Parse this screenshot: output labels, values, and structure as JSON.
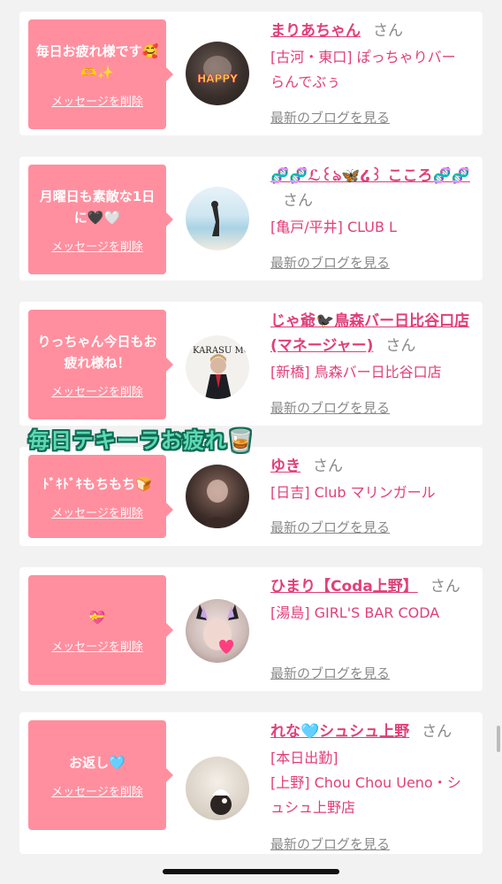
{
  "overlay_sticker": "毎日テキーラお疲れ🥃",
  "cards": [
    {
      "message": "毎日お疲れ様です🥰🫶✨",
      "delete_label": "メッセージを削除",
      "name": "まりあちゃん",
      "honorific": "さん",
      "shop": "[古河・東口] ぽっちゃりバー らんでぶぅ",
      "blog_label": "最新のブログを見る",
      "avatar_text": "HAPPY"
    },
    {
      "message": "月曜日も素敵な1日に🖤🤍",
      "delete_label": "メッセージを削除",
      "name": "🧬🧬ℒ꒰ঌ🦋໒꒱ こころ🧬🧬",
      "honorific": "さん",
      "shop": "[亀戸/平井] CLUB L",
      "blog_label": "最新のブログを見る"
    },
    {
      "message": "りっちゃん今日もお疲れ様ね！",
      "delete_label": "メッセージを削除",
      "name": "じゃ爺🐦‍⬛鳥森バー日比谷口店(マネージャー)",
      "honorific": "さん",
      "shop": "[新橋] 鳥森バー日比谷口店",
      "blog_label": "最新のブログを見る",
      "avatar_text": "KARASU MORI BAR"
    },
    {
      "message": "ﾄﾞｷﾄﾞｷもちもち🍞",
      "delete_label": "メッセージを削除",
      "name": "ゆき",
      "honorific": "さん",
      "shop": "[日吉] Club マリンガール",
      "blog_label": "最新のブログを見る"
    },
    {
      "message": "💝",
      "delete_label": "メッセージを削除",
      "name": "ひまり【Coda上野】",
      "honorific": "さん",
      "shop": "[湯島] GIRL'S BAR CODA",
      "blog_label": "最新のブログを見る"
    },
    {
      "message": "お返し🩵",
      "delete_label": "メッセージを削除",
      "name": "れな🩵シュシュ上野",
      "honorific": "さん",
      "shop": "[本日出勤]",
      "shop2": "[上野] Chou Chou Ueno・シュシュ上野店",
      "blog_label": "最新のブログを見る"
    }
  ]
}
